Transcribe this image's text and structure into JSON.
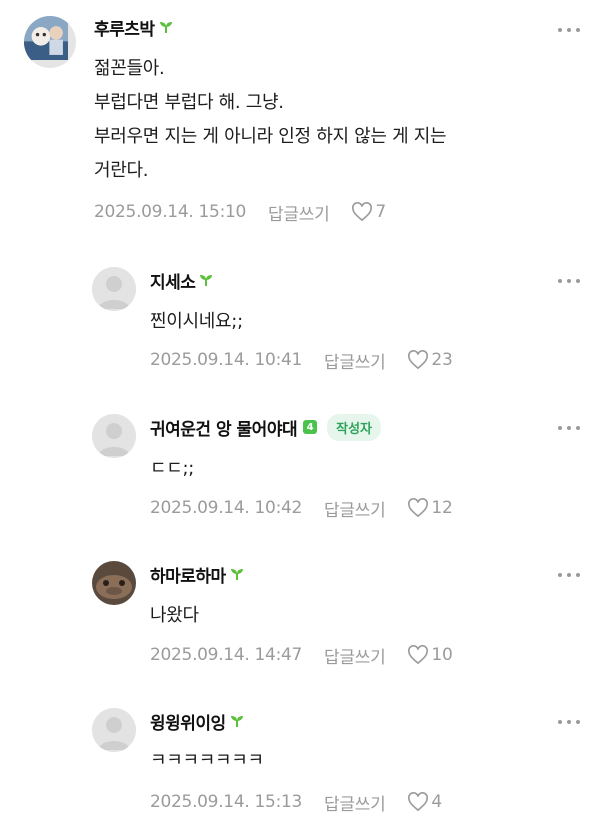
{
  "comments": [
    {
      "author": "후루츠박",
      "lines": "젊꼰들아.\n부럽다면 부럽다 해. 그냥.\n부러우면 지는 게 아니라 인정 하지 않는 게 지는\n거란다.",
      "timestamp": "2025.09.14. 15:10",
      "reply_label": "답글쓰기",
      "likes": "7"
    },
    {
      "author": "지세소",
      "lines": "찐이시네요;;",
      "timestamp": "2025.09.14. 10:41",
      "reply_label": "답글쓰기",
      "likes": "23"
    },
    {
      "author": "귀여운건 앙 물어야대",
      "level": "4",
      "badge": "작성자",
      "lines": "ㄷㄷ;;",
      "timestamp": "2025.09.14. 10:42",
      "reply_label": "답글쓰기",
      "likes": "12"
    },
    {
      "author": "하마로하마",
      "lines": "나왔다",
      "timestamp": "2025.09.14. 14:47",
      "reply_label": "답글쓰기",
      "likes": "10"
    },
    {
      "author": "윙윙위이잉",
      "lines": "ㅋㅋㅋㅋㅋㅋㅋ",
      "timestamp": "2025.09.14. 15:13",
      "reply_label": "답글쓰기",
      "likes": "4"
    }
  ],
  "icons": {
    "sprout": "sprout-icon",
    "heart": "heart-icon",
    "more": "more-dots-icon"
  },
  "colors": {
    "meta_gray": "#9b9b9b",
    "badge_green": "#2ea35a",
    "sprout_green": "#5bbf3a"
  }
}
